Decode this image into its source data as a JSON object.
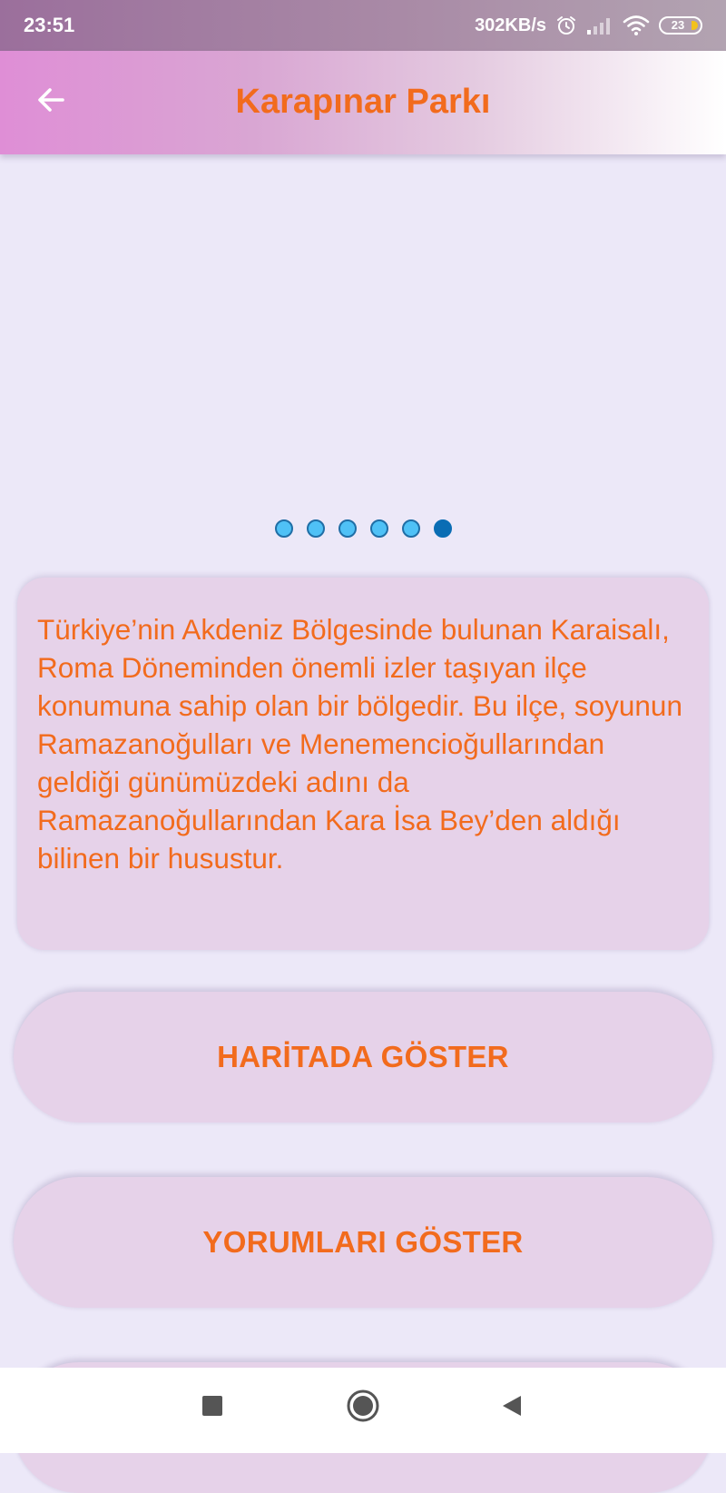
{
  "status_bar": {
    "time": "23:51",
    "network_speed": "302KB/s",
    "battery_level": "23",
    "icons": [
      "alarm-icon",
      "signal-icon",
      "wifi-icon",
      "battery-icon"
    ]
  },
  "app_bar": {
    "title": "Karapınar Parkı",
    "back_icon": "arrow-left-icon"
  },
  "carousel": {
    "slide_count": 6,
    "active_index": 5
  },
  "description": {
    "text": "Türkiye’nin Akdeniz Bölgesinde bulunan Karaisalı, Roma Döneminden önemli izler taşıyan ilçe konumuna sahip olan bir bölgedir. Bu ilçe, soyunun Ramazanoğulları ve Menemencioğullarından geldiği günümüzdeki adını da Ramazanoğullarından Kara İsa Bey’den aldığı bilinen bir husustur."
  },
  "buttons": {
    "show_on_map": "HARİTADA GÖSTER",
    "show_comments": "YORUMLARI GÖSTER"
  },
  "nav_bar": {
    "icons": [
      "recent-apps-icon",
      "home-icon",
      "back-icon"
    ]
  },
  "colors": {
    "accent": "#f26b1d",
    "card": "#e6d2e9",
    "background": "#ece8f8",
    "dot": "#4fc1f6",
    "dot_active": "#0a6db4"
  }
}
